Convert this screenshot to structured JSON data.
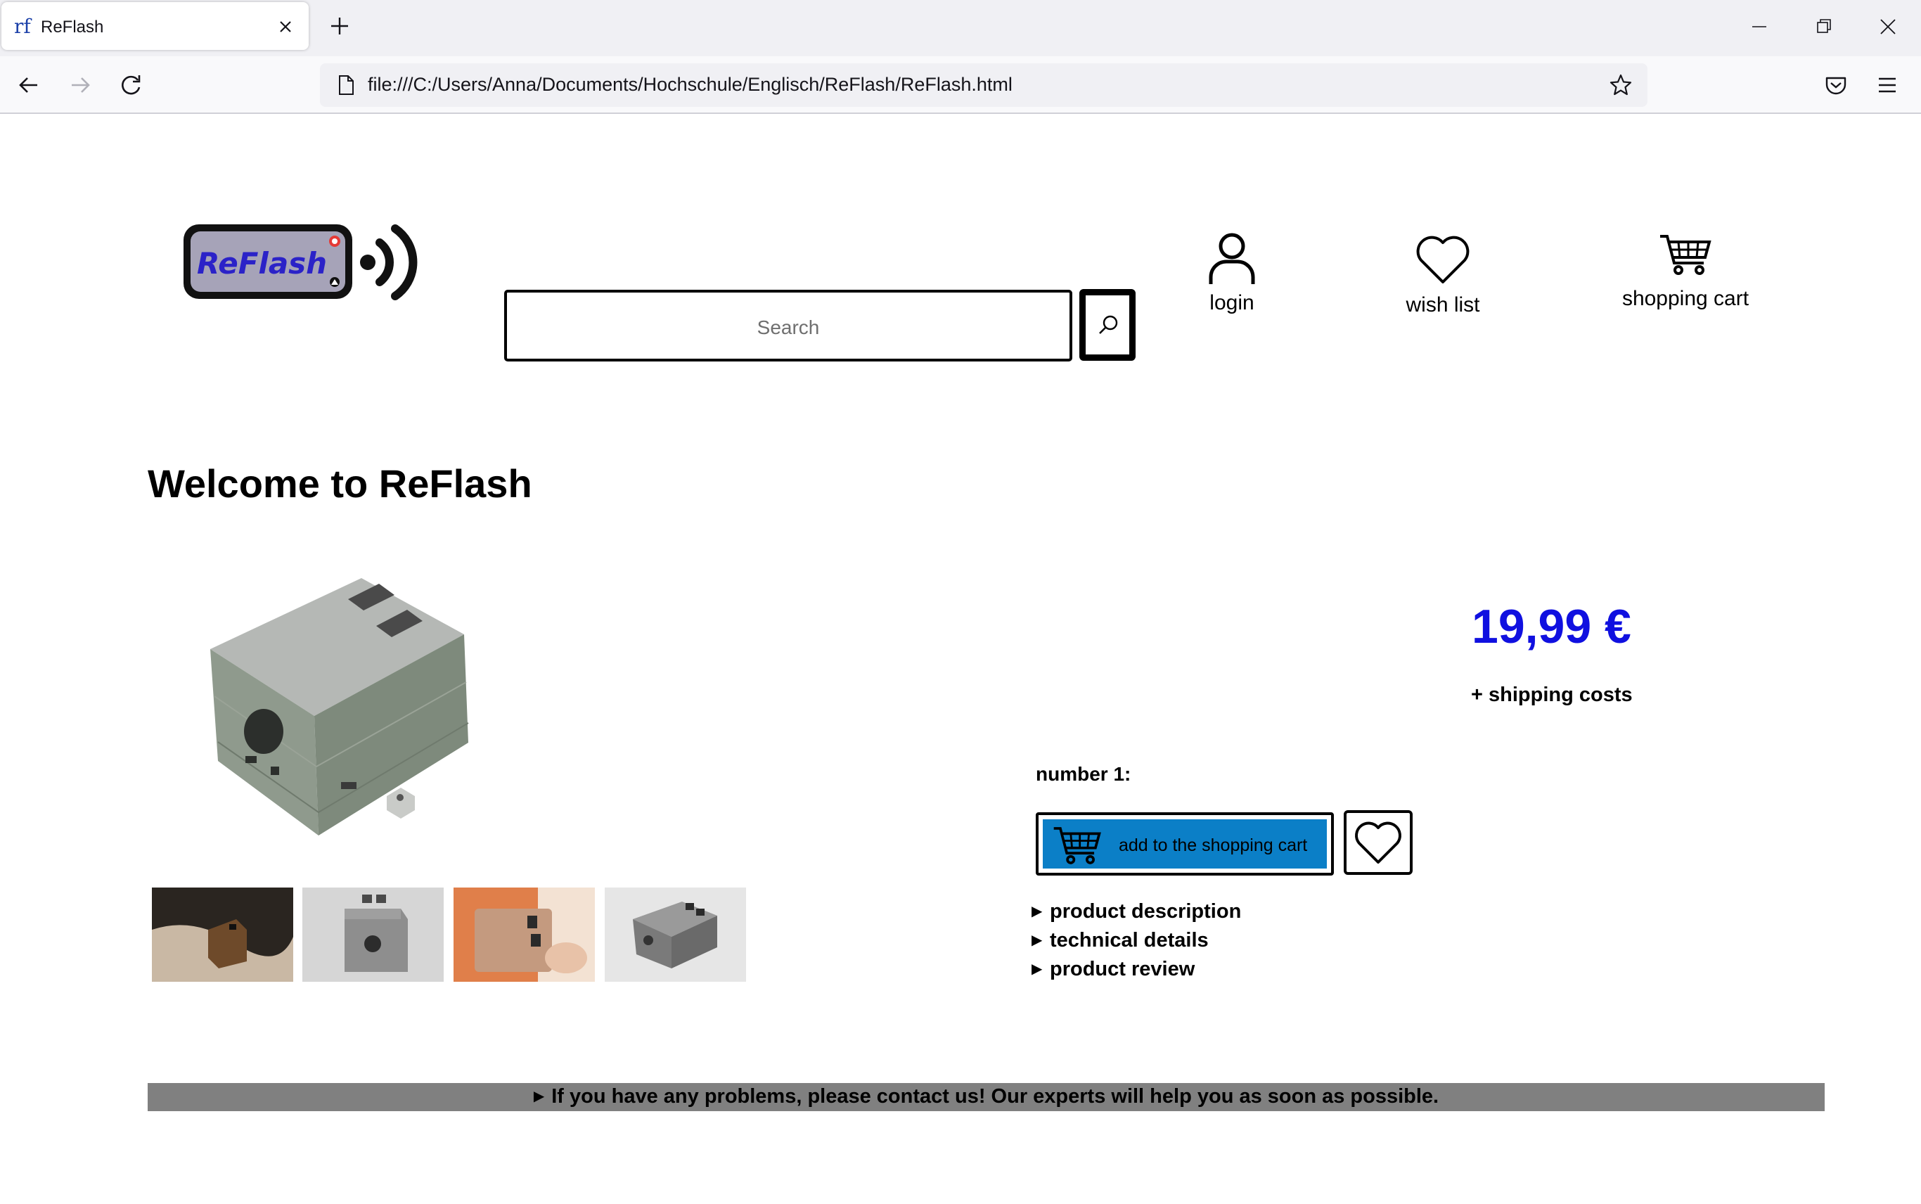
{
  "browser": {
    "tab_title": "ReFlash",
    "favicon_text": "rf",
    "url": "file:///C:/Users/Anna/Documents/Hochschule/Englisch/ReFlash/ReFlash.html"
  },
  "header": {
    "logo_text": "ReFlash",
    "search_placeholder": "Search",
    "login_label": "login",
    "wishlist_label": "wish list",
    "cart_label": "shopping cart"
  },
  "main": {
    "title": "Welcome to ReFlash",
    "price": "19,99 €",
    "shipping": "+ shipping costs",
    "quantity_label": "number 1:",
    "add_to_cart_label": "add to the shopping cart",
    "details": [
      {
        "label": "product description"
      },
      {
        "label": "technical details"
      },
      {
        "label": "product review"
      }
    ]
  },
  "footer": {
    "notice": "If you have any problems, please contact us! Our experts will help you as soon as possible."
  },
  "colors": {
    "price": "#1010e0",
    "cart_button": "#0b7fc7",
    "footer_bar": "#808080"
  }
}
